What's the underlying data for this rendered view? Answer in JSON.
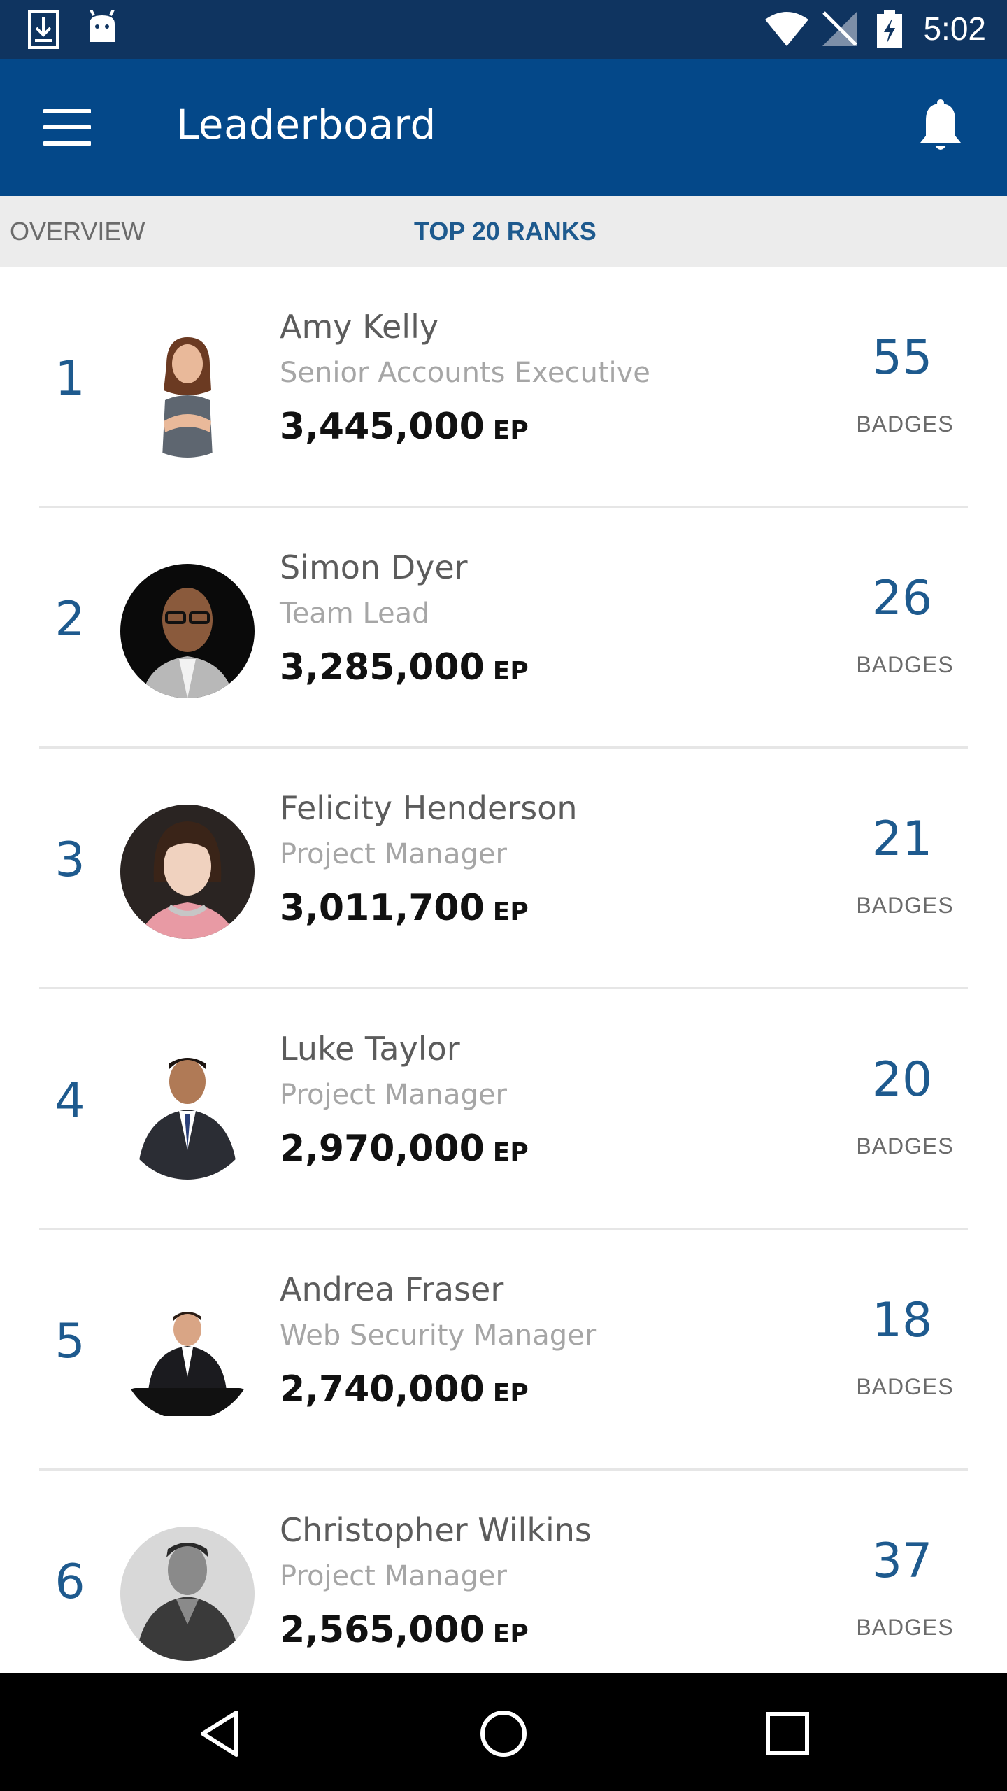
{
  "status_bar": {
    "time": "5:02"
  },
  "app_bar": {
    "title": "Leaderboard"
  },
  "tabs": [
    {
      "label": "OVERVIEW",
      "selected": false
    },
    {
      "label": "TOP 20 RANKS",
      "selected": true
    }
  ],
  "leaderboard": [
    {
      "rank": "1",
      "name": "Amy Kelly",
      "role": "Senior Accounts Executive",
      "points": "3,445,000",
      "unit": "EP",
      "badges": "55",
      "badges_label": "BADGES",
      "avatar": "woman-avatar"
    },
    {
      "rank": "2",
      "name": "Simon Dyer",
      "role": "Team Lead",
      "points": "3,285,000",
      "unit": "EP",
      "badges": "26",
      "badges_label": "BADGES",
      "avatar": "man-glasses-avatar"
    },
    {
      "rank": "3",
      "name": "Felicity Henderson",
      "role": "Project Manager",
      "points": "3,011,700",
      "unit": "EP",
      "badges": "21",
      "badges_label": "BADGES",
      "avatar": "woman-avatar"
    },
    {
      "rank": "4",
      "name": "Luke Taylor",
      "role": "Project Manager",
      "points": "2,970,000",
      "unit": "EP",
      "badges": "20",
      "badges_label": "BADGES",
      "avatar": "man-suit-avatar"
    },
    {
      "rank": "5",
      "name": "Andrea Fraser",
      "role": "Web Security Manager",
      "points": "2,740,000",
      "unit": "EP",
      "badges": "18",
      "badges_label": "BADGES",
      "avatar": "man-suit-avatar"
    },
    {
      "rank": "6",
      "name": "Christopher Wilkins",
      "role": "Project Manager",
      "points": "2,565,000",
      "unit": "EP",
      "badges": "37",
      "badges_label": "BADGES",
      "avatar": "man-avatar"
    }
  ],
  "colors": {
    "status_bar": "#0f3460",
    "app_bar": "#044889",
    "accent": "#1e5a8e",
    "tab_bar": "#ececec"
  }
}
